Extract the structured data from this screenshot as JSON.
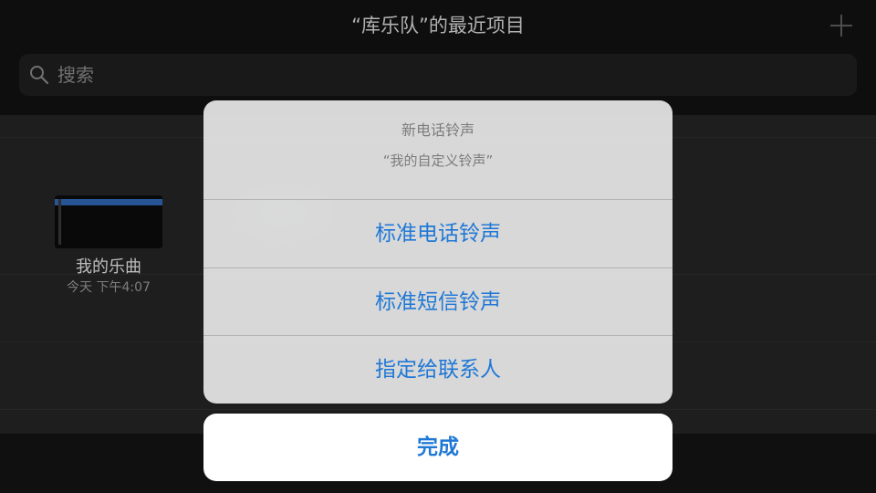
{
  "header": {
    "title": "“库乐队”的最近项目",
    "add_icon": "plus-icon"
  },
  "search": {
    "placeholder": "搜索",
    "value": "",
    "icon": "search-icon"
  },
  "projects": [
    {
      "name": "我的乐曲",
      "date": "今天 下午4:07"
    }
  ],
  "action_sheet": {
    "title": "新电话铃声",
    "message": "“我的自定义铃声”",
    "actions": [
      {
        "label": "标准电话铃声"
      },
      {
        "label": "标准短信铃声"
      },
      {
        "label": "指定给联系人"
      }
    ],
    "done_label": "完成"
  },
  "colors": {
    "accent": "#1f78d6",
    "sheet_background": "#e4e4e4",
    "app_background": "#1b1b1b"
  }
}
